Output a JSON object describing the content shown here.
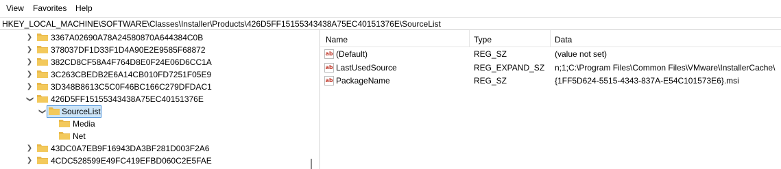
{
  "menu": {
    "view": "View",
    "favorites": "Favorites",
    "help": "Help"
  },
  "address": {
    "path": "HKEY_LOCAL_MACHINE\\SOFTWARE\\Classes\\Installer\\Products\\426D5FF15155343438A75EC40151376E\\SourceList"
  },
  "tree": {
    "items": [
      {
        "label": "3367A02690A78A24580870A644384C0B",
        "expanded": false
      },
      {
        "label": "378037DF1D33F1D4A90E2E9585F68872",
        "expanded": false
      },
      {
        "label": "382CD8CF58A4F764D8E0F24E06D6CC1A",
        "expanded": false
      },
      {
        "label": "3C263CBEDB2E6A14CB010FD7251F05E9",
        "expanded": false
      },
      {
        "label": "3D348B8613C5C0F46BC166C279DFDAC1",
        "expanded": false
      },
      {
        "label": "426D5FF15155343438A75EC40151376E",
        "expanded": true
      },
      {
        "label": "SourceList",
        "expanded": true,
        "selected": true
      },
      {
        "label": "Media"
      },
      {
        "label": "Net"
      },
      {
        "label": "43DC0A7EB9F16943DA3BF281D003F2A6",
        "expanded": false
      },
      {
        "label": "4CDC528599E49FC419EFBD060C2E5FAE",
        "expanded": false
      }
    ]
  },
  "values": {
    "headers": {
      "name": "Name",
      "type": "Type",
      "data": "Data"
    },
    "rows": [
      {
        "name": "(Default)",
        "type": "REG_SZ",
        "data": "(value not set)",
        "icon": "string-value-icon"
      },
      {
        "name": "LastUsedSource",
        "type": "REG_EXPAND_SZ",
        "data": "n;1;C:\\Program Files\\Common Files\\VMware\\InstallerCache\\",
        "icon": "string-value-icon"
      },
      {
        "name": "PackageName",
        "type": "REG_SZ",
        "data": "{1FF5D624-5515-4343-837A-E54C101573E6}.msi",
        "icon": "string-value-icon"
      }
    ]
  },
  "colors": {
    "folder": "#e8b84a",
    "selection": "#cce4f7",
    "selection_border": "#4a90d9",
    "ab_red": "#c0392b"
  }
}
